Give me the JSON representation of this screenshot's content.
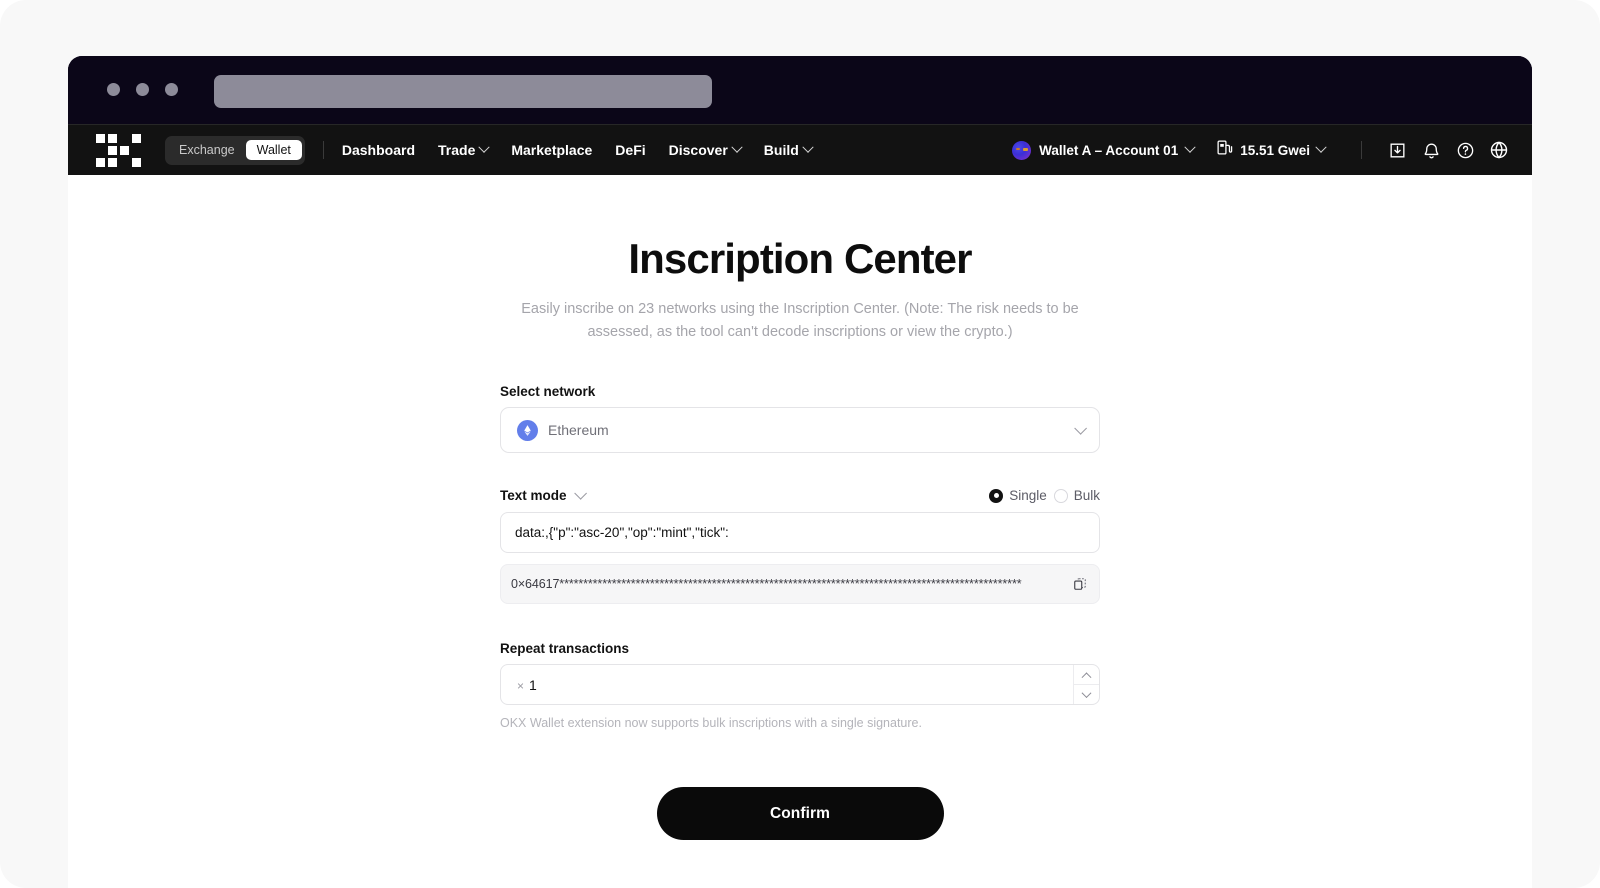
{
  "browser": {
    "traffic_dots": [
      "dot-1",
      "dot-2",
      "dot-3"
    ],
    "address_bar_value": ""
  },
  "nav": {
    "logo": "okx-logo",
    "segments": [
      {
        "label": "Exchange",
        "active": false
      },
      {
        "label": "Wallet",
        "active": true
      }
    ],
    "links": [
      {
        "label": "Dashboard",
        "has_caret": false
      },
      {
        "label": "Trade",
        "has_caret": true
      },
      {
        "label": "Marketplace",
        "has_caret": false
      },
      {
        "label": "DeFi",
        "has_caret": false
      },
      {
        "label": "Discover",
        "has_caret": true
      },
      {
        "label": "Build",
        "has_caret": true
      }
    ],
    "wallet": {
      "label": "Wallet A – Account 01",
      "avatar": "wallet-avatar"
    },
    "gas": {
      "label": "15.51 Gwei",
      "icon": "gas-pump-icon"
    },
    "icons": [
      "download-icon",
      "bell-icon",
      "help-circle-icon",
      "globe-icon"
    ]
  },
  "main": {
    "title": "Inscription Center",
    "subtitle": "Easily inscribe on 23 networks using the Inscription Center. (Note: The risk needs to be assessed, as the tool can't decode inscriptions or view the crypto.)",
    "network": {
      "label": "Select network",
      "selected": "Ethereum",
      "icon": "ethereum-icon"
    },
    "text_mode": {
      "label": "Text mode",
      "options": [
        {
          "label": "Single",
          "checked": true
        },
        {
          "label": "Bulk",
          "checked": false
        }
      ],
      "input_value": "data:,{\"p\":\"asc-20\",\"op\":\"mint\",\"tick\":",
      "hash_value": "0×64617*************************************************************************************************",
      "copy_icon": "copy-icon"
    },
    "repeat": {
      "label": "Repeat transactions",
      "prefix": "×",
      "value": "1",
      "helper": "OKX Wallet extension now supports bulk inscriptions with a single signature."
    },
    "confirm_label": "Confirm"
  },
  "colors": {
    "accent_dark": "#121212",
    "ethereum": "#627eea",
    "nav_bg": "#121212",
    "chrome_bg": "#0b0618"
  }
}
